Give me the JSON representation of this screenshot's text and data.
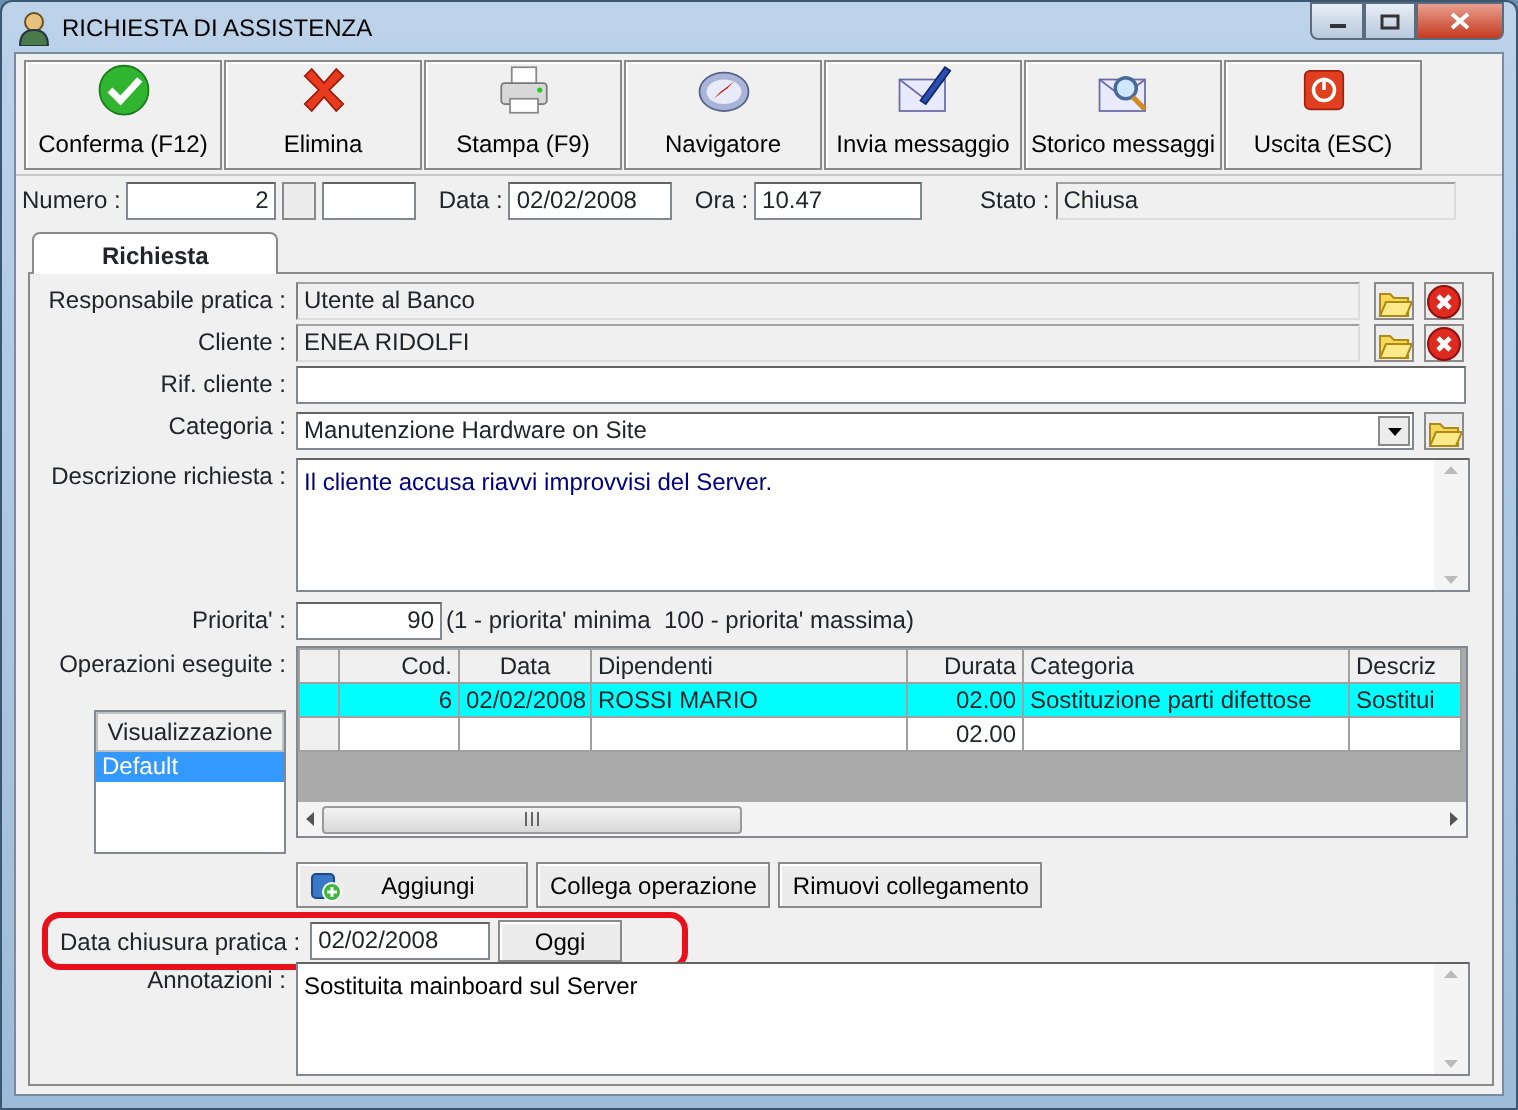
{
  "window": {
    "title": "RICHIESTA DI ASSISTENZA"
  },
  "toolbar": [
    {
      "label": "Conferma (F12)",
      "kind": "check"
    },
    {
      "label": "Elimina",
      "kind": "cross"
    },
    {
      "label": "Stampa (F9)",
      "kind": "printer"
    },
    {
      "label": "Navigatore",
      "kind": "compass"
    },
    {
      "label": "Invia messaggio",
      "kind": "mail-pen"
    },
    {
      "label": "Storico messaggi",
      "kind": "mail-search"
    },
    {
      "label": "Uscita (ESC)",
      "kind": "power"
    }
  ],
  "header": {
    "numero": {
      "label": "Numero :",
      "value": "2"
    },
    "data": {
      "label": "Data :",
      "value": "02/02/2008"
    },
    "ora": {
      "label": "Ora :",
      "value": "10.47"
    },
    "stato": {
      "label": "Stato :",
      "value": "Chiusa"
    }
  },
  "tabs": [
    {
      "label": "Richiesta",
      "selected": true
    }
  ],
  "fields": [
    {
      "kind": "lookup",
      "label": "Responsabile pratica :",
      "value": "Utente al Banco"
    },
    {
      "kind": "lookup",
      "label": "Cliente :",
      "value": "ENEA RIDOLFI"
    },
    {
      "kind": "text",
      "label": "Rif. cliente :"
    },
    {
      "kind": "select",
      "label": "Categoria :",
      "value": "Manutenzione Hardware on Site"
    },
    {
      "kind": "memo",
      "label": "Descrizione richiesta :",
      "value": "Il cliente accusa riavvi improvvisi del Server."
    }
  ],
  "priority": {
    "label": "Priorita' :",
    "value": "90",
    "hint": "(1 - priorita' minima  100 - priorita' massima)"
  },
  "operations": {
    "label": "Operazioni eseguite :",
    "views": {
      "heading": "Visualizzazione",
      "items": [
        {
          "label": "Default",
          "selected": true
        }
      ]
    },
    "table": {
      "columns": [
        "Cod.",
        "Data",
        "Dipendenti",
        "Durata",
        "Categoria",
        "Descriz"
      ],
      "rows": [
        {
          "cells": [
            "6",
            "02/02/2008",
            "ROSSI MARIO",
            "02.00",
            "Sostituzione parti difettose",
            "Sostitui"
          ],
          "selected": true
        },
        {
          "cells": [
            "",
            "",
            "",
            "02.00",
            "",
            ""
          ],
          "selected": false
        }
      ]
    },
    "buttons": [
      "Aggiungi",
      "Collega operazione",
      "Rimuovi collegamento"
    ]
  },
  "closing_date": {
    "label": "Data chiusura pratica :",
    "value": "02/02/2008",
    "button": "Oggi",
    "highlighted": true
  },
  "notes": {
    "label": "Annotazioni :",
    "value": "Sostituita mainboard sul Server"
  }
}
